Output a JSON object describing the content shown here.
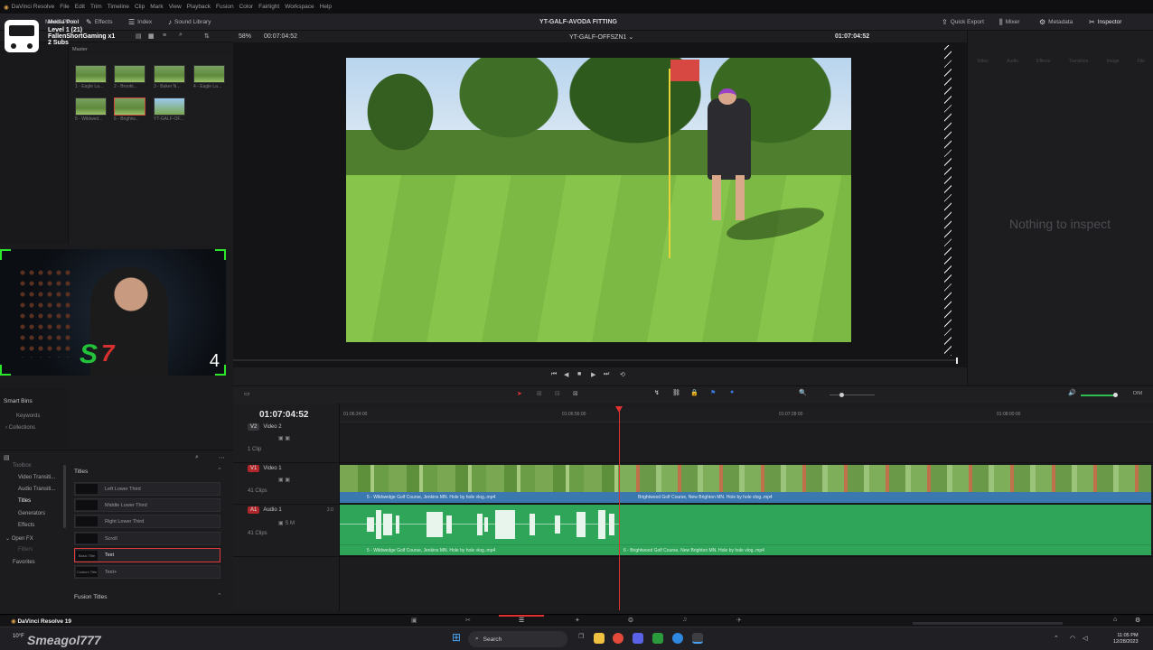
{
  "titlebar": {
    "app_name": "DaVinci Resolve",
    "menu": [
      "File",
      "Edit",
      "Trim",
      "Timeline",
      "Clip",
      "Mark",
      "View",
      "Playback",
      "Fusion",
      "Color",
      "Fairlight",
      "Workspace",
      "Help"
    ]
  },
  "toolbar": {
    "media_pool": "Media Pool",
    "effects": "Effects",
    "index": "Index",
    "sound_library": "Sound Library",
    "project_title": "YT-GALF-AVODA FITTING",
    "quick_export": "Quick Export",
    "mixer": "Mixer",
    "metadata": "Metadata",
    "inspector": "Inspector"
  },
  "overlay": {
    "line1": "Level 1  (21)",
    "line2": "FallenShortGaming x1",
    "line3": "2 Subs",
    "master": "Master"
  },
  "viewer": {
    "zoom": "58%",
    "source_timecode": "00:07:04:52",
    "timeline_name": "YT-GALF-OFFSZN1",
    "record_timecode": "01:07:04:52"
  },
  "media_pool": {
    "thumbs": [
      {
        "label": "1 - Eagle La..."
      },
      {
        "label": "2 - Brookt..."
      },
      {
        "label": "3 - Baker N..."
      },
      {
        "label": "4 - Eagle La..."
      },
      {
        "label": "5 - Wildwed..."
      },
      {
        "label": "6 - Brightw..."
      },
      {
        "label": "YT-GALF-OF..."
      }
    ]
  },
  "inspector": {
    "tabs": [
      "Video",
      "Audio",
      "Effects",
      "Transition",
      "Image",
      "File"
    ],
    "empty_text": "Nothing to inspect"
  },
  "timeline": {
    "current_timecode": "01:07:04:52",
    "ruler": [
      "01:06:24:00",
      "01:06:56:00",
      "01:07:28:00",
      "01:08:00:00"
    ],
    "tracks": {
      "v2": {
        "id": "V2",
        "name": "Video 2",
        "clips": "1 Clip"
      },
      "v1": {
        "id": "V1",
        "name": "Video 1",
        "clips": "41 Clips"
      },
      "a1": {
        "id": "A1",
        "name": "Audio 1",
        "clips": "41 Clips",
        "channel": "2.0"
      }
    },
    "video_clips": [
      {
        "label": "5 - Wildwedge Golf Course, Jenkins MN.  Hole by hole vlog..mp4"
      },
      {
        "label": "Brightwood Golf Course, New Brighton MN.  Hole by hole vlog..mp4"
      }
    ],
    "audio_clips": [
      {
        "label": "5 - Wildwedge Golf Course, Jenkins MN.  Hole by hole vlog..mp4"
      },
      {
        "label": "6 - Brightwood Golf Course, New Brighton MN.  Hole by hole vlog..mp4"
      }
    ],
    "audio_level": "DIM"
  },
  "left_panel": {
    "smart_bins": "Smart Bins",
    "keywords": "Keywords",
    "collections": "Collections"
  },
  "effects_panel": {
    "categories": [
      "Toolbox",
      "Video Transiti...",
      "Audio Transiti...",
      "Titles",
      "Generators",
      "Effects",
      "Open FX",
      "Filters",
      "Favorites"
    ],
    "section_titles": "Titles",
    "items": [
      {
        "thumb": "",
        "label": "Left Lower Third"
      },
      {
        "thumb": "",
        "label": "Middle Lower Third"
      },
      {
        "thumb": "",
        "label": "Right Lower Third"
      },
      {
        "thumb": "",
        "label": "Scroll"
      },
      {
        "thumb": "Basic Title",
        "label": "Text"
      },
      {
        "thumb": "Custom Title",
        "label": "Text+"
      }
    ],
    "section_fusion": "Fusion Titles"
  },
  "pagebar": {
    "app_label": "DaVinci Resolve 19"
  },
  "taskbar": {
    "search": "Search",
    "weather": "10°F",
    "watermark": "Smeagol777",
    "time": "11:05 PM",
    "date": "12/28/2023"
  },
  "colors": {
    "accent_red": "#e03232",
    "video_clip": "#3b78b0",
    "audio_clip": "#2ea559"
  }
}
